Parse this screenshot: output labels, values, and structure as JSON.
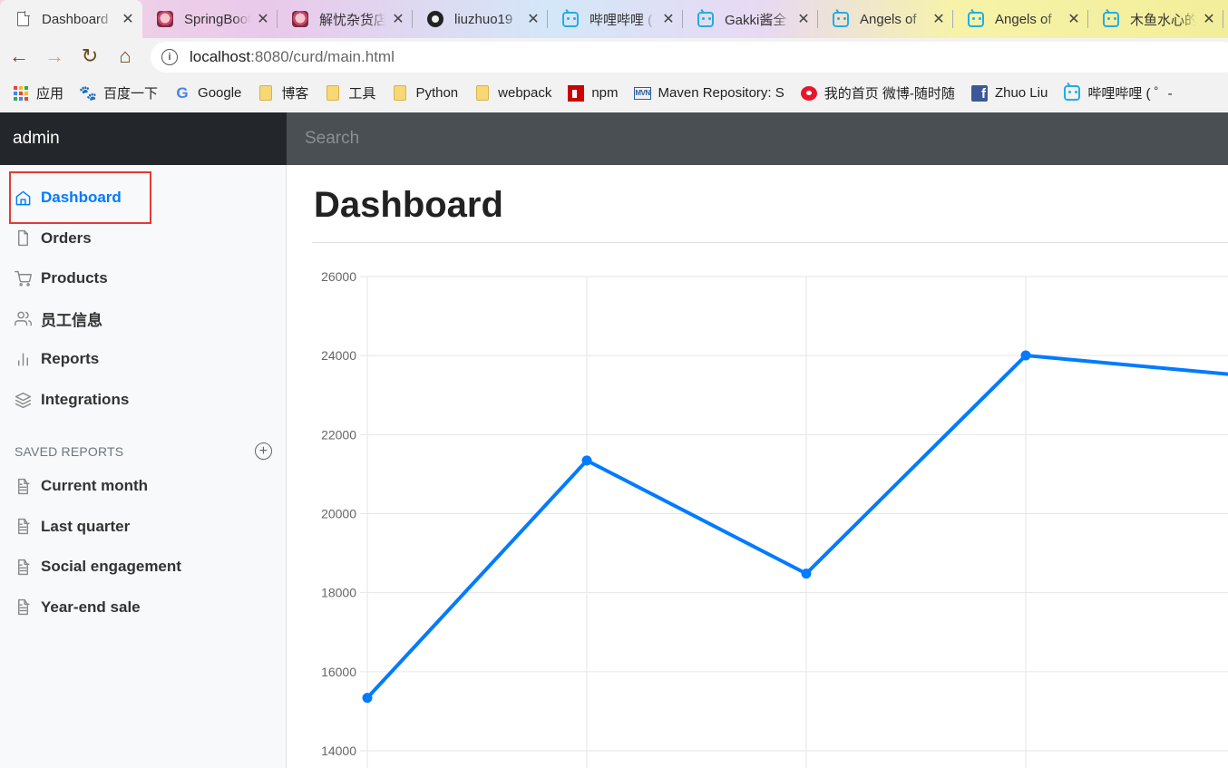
{
  "browser": {
    "tabs": [
      {
        "title": "Dashboard",
        "icon": "document-icon",
        "active": true
      },
      {
        "title": "SpringBoot",
        "icon": "anime-avatar-icon",
        "active": false
      },
      {
        "title": "解忧杂货店",
        "icon": "anime-avatar-icon",
        "active": false
      },
      {
        "title": "liuzhuo19",
        "icon": "github-icon",
        "active": false
      },
      {
        "title": "哔哩哔哩 (",
        "icon": "bilibili-icon",
        "active": false
      },
      {
        "title": "Gakki酱全",
        "icon": "bilibili-icon",
        "active": false
      },
      {
        "title": "Angels of",
        "icon": "bilibili-icon",
        "active": false
      },
      {
        "title": "Angels of",
        "icon": "bilibili-icon",
        "active": false
      },
      {
        "title": "木鱼水心的",
        "icon": "bilibili-icon",
        "active": false
      }
    ],
    "tab_close_glyph": "✕",
    "url_host": "localhost",
    "url_rest": ":8080/curd/main.html",
    "bookmarks": [
      {
        "label": "应用",
        "icon": "apps-icon"
      },
      {
        "label": "百度一下",
        "icon": "baidu-icon"
      },
      {
        "label": "Google",
        "icon": "google-icon"
      },
      {
        "label": "博客",
        "icon": "folder-icon"
      },
      {
        "label": "工具",
        "icon": "folder-icon"
      },
      {
        "label": "Python",
        "icon": "folder-icon"
      },
      {
        "label": "webpack",
        "icon": "folder-icon"
      },
      {
        "label": "npm",
        "icon": "npm-icon"
      },
      {
        "label": "Maven Repository: S",
        "icon": "maven-icon"
      },
      {
        "label": "我的首页 微博-随时随",
        "icon": "weibo-icon"
      },
      {
        "label": "Zhuo Liu",
        "icon": "facebook-icon"
      },
      {
        "label": "哔哩哔哩 ( ゜-",
        "icon": "bilibili-icon"
      }
    ]
  },
  "navbar": {
    "brand": "admin",
    "search_placeholder": "Search"
  },
  "sidebar": {
    "items": [
      {
        "label": "Dashboard",
        "icon": "home-icon",
        "active": true
      },
      {
        "label": "Orders",
        "icon": "file-icon",
        "active": false
      },
      {
        "label": "Products",
        "icon": "shopping-cart-icon",
        "active": false
      },
      {
        "label": "员工信息",
        "icon": "users-icon",
        "active": false
      },
      {
        "label": "Reports",
        "icon": "bar-chart-icon",
        "active": false
      },
      {
        "label": "Integrations",
        "icon": "layers-icon",
        "active": false
      }
    ],
    "saved_reports_heading": "SAVED REPORTS",
    "saved_reports": [
      {
        "label": "Current month",
        "icon": "file-text-icon"
      },
      {
        "label": "Last quarter",
        "icon": "file-text-icon"
      },
      {
        "label": "Social engagement",
        "icon": "file-text-icon"
      },
      {
        "label": "Year-end sale",
        "icon": "file-text-icon"
      }
    ]
  },
  "main": {
    "title": "Dashboard"
  },
  "colors": {
    "accent": "#007bff",
    "navbar_bg": "#343a40",
    "highlight_box": "#e53935"
  },
  "chart_data": {
    "type": "line",
    "title": "",
    "xlabel": "",
    "ylabel": "",
    "y_ticks": [
      26000,
      24000,
      22000,
      20000,
      18000,
      16000,
      14000
    ],
    "ylim_visible": [
      14000,
      26000
    ],
    "grid": true,
    "series": [
      {
        "values": [
          15339,
          21345,
          18483,
          24003,
          23489
        ]
      }
    ],
    "line_color": "#007bff"
  }
}
